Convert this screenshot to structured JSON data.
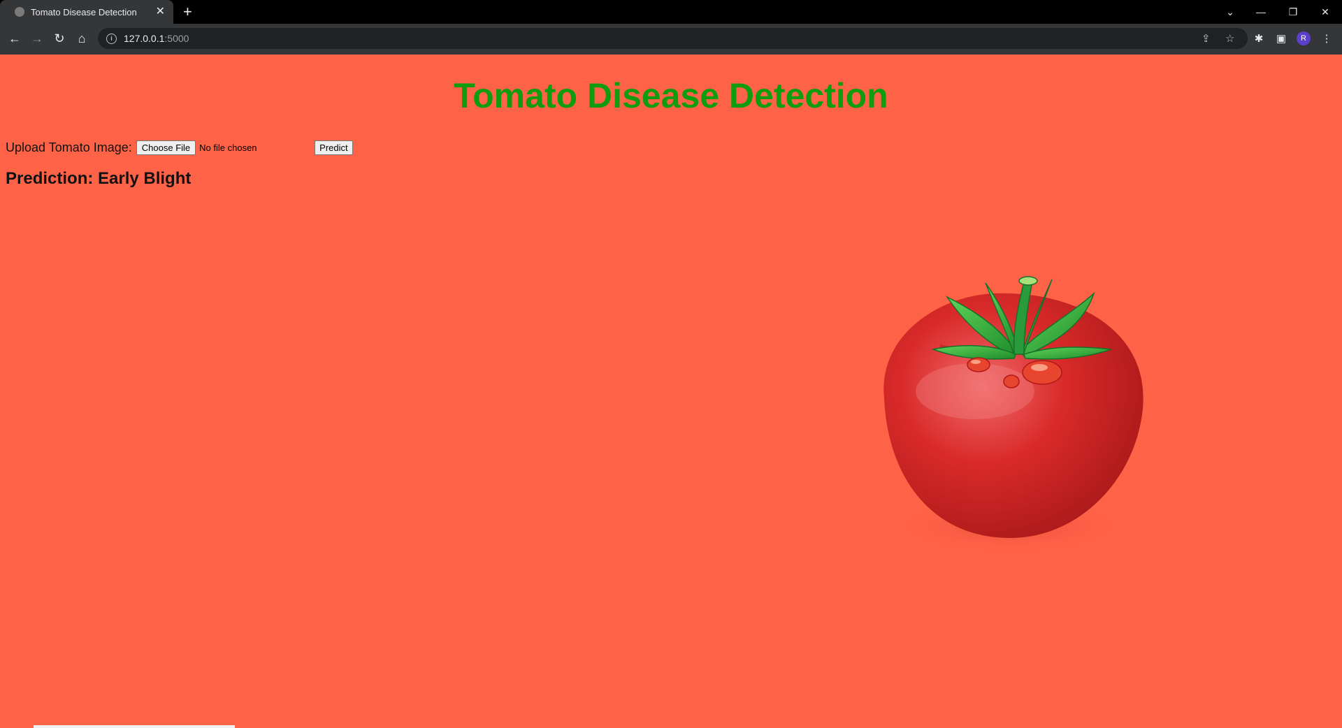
{
  "browser": {
    "tab_title": "Tomato Disease Detection",
    "tab_close": "✕",
    "new_tab": "+",
    "url_host": "127.0.0.1",
    "url_port": ":5000",
    "profile_initial": "R"
  },
  "page": {
    "title": "Tomato Disease Detection",
    "upload_label": "Upload Tomato Image:",
    "choose_file_label": "Choose File",
    "file_status": "No file chosen",
    "predict_label": "Predict",
    "prediction_text": "Prediction: Early Blight"
  },
  "colors": {
    "background": "#ff6347",
    "title": "#0f9d0f"
  }
}
